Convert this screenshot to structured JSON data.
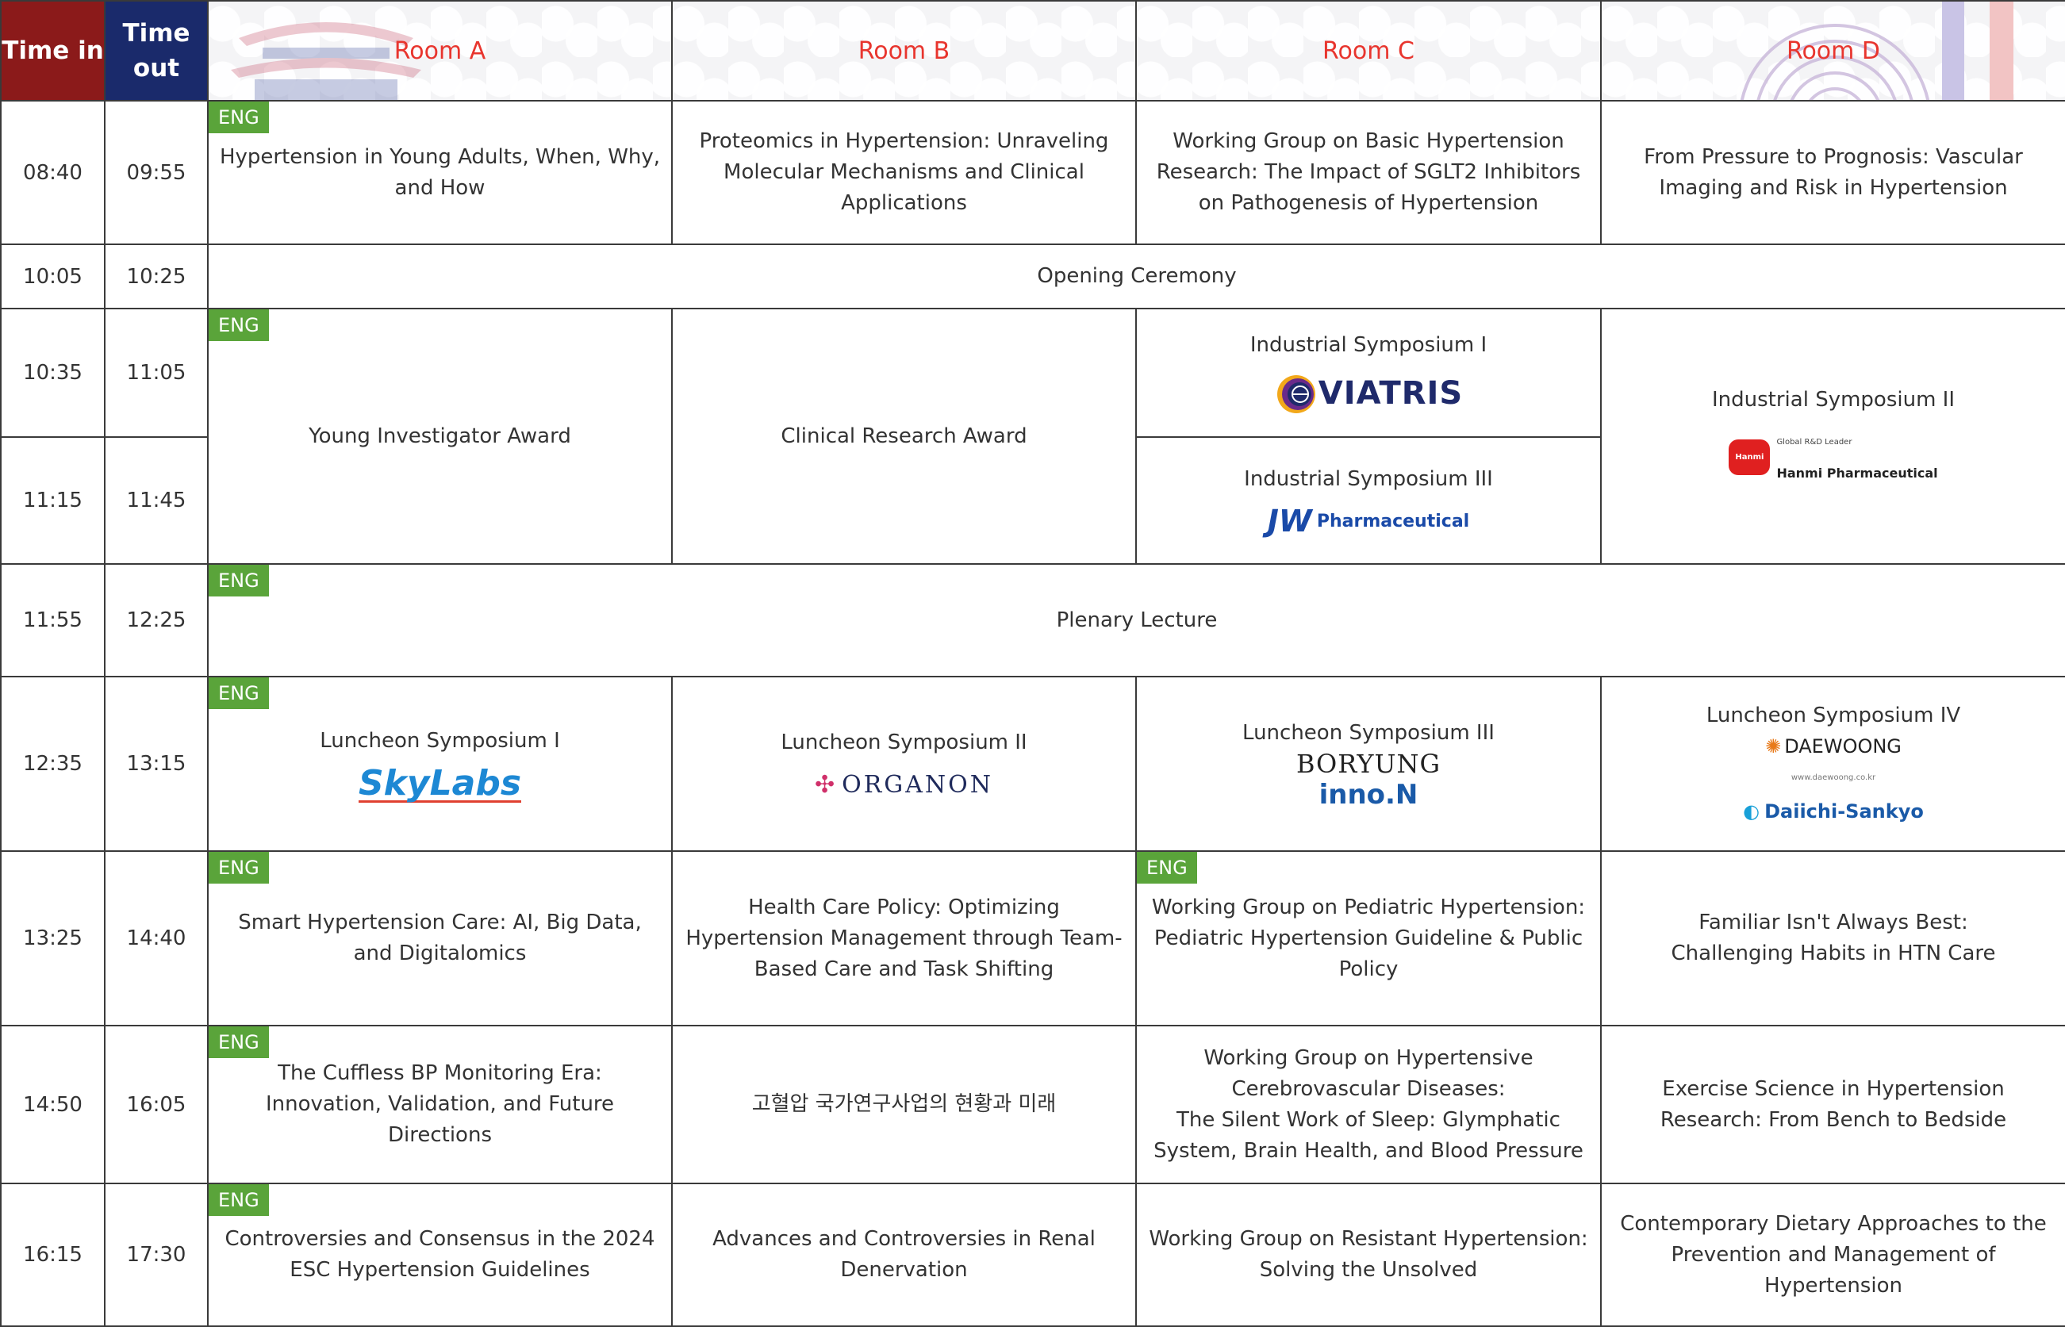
{
  "header": {
    "time_in": "Time in",
    "time_out": "Time out",
    "rooms": [
      "Room A",
      "Room B",
      "Room C",
      "Room D"
    ]
  },
  "eng_badge": "ENG",
  "rows": {
    "r1": {
      "in": "08:40",
      "out": "09:55",
      "a": "Hypertension in Young Adults, When, Why, and How",
      "b": "Proteomics in Hypertension: Unraveling Molecular Mechanisms and Clinical Applications",
      "c": "Working Group on Basic Hypertension Research: The Impact of SGLT2 Inhibitors on Pathogenesis of Hypertension",
      "d": "From Pressure to Prognosis: Vascular Imaging and Risk in Hypertension"
    },
    "r2": {
      "in": "10:05",
      "out": "10:25",
      "all": "Opening Ceremony"
    },
    "r3": {
      "in": "10:35",
      "out": "11:05",
      "a": "Young Investigator Award",
      "b": "Clinical Research Award",
      "c": "Industrial Symposium I",
      "c_logo": "VIATRIS",
      "d": "Industrial Symposium II",
      "d_logo_tag": "Global R&D Leader",
      "d_logo": "Hanmi Pharmaceutical",
      "d_logo_pill": "Hanmi"
    },
    "r4": {
      "in": "11:15",
      "out": "11:45",
      "c": "Industrial Symposium III",
      "c_logo_mark": "JW",
      "c_logo": "Pharmaceutical"
    },
    "r5": {
      "in": "11:55",
      "out": "12:25",
      "all": "Plenary Lecture"
    },
    "r6": {
      "in": "12:35",
      "out": "13:15",
      "a": "Luncheon Symposium I",
      "a_logo": "SkyLabs",
      "b": "Luncheon Symposium II",
      "b_logo": "ORGANON",
      "c": "Luncheon Symposium III",
      "c_logo1": "BORYUNG",
      "c_logo2": "inno.N",
      "d": "Luncheon Symposium IV",
      "d_logo1": "DAEWOONG",
      "d_logo1_url": "www.daewoong.co.kr",
      "d_logo2": "Daiichi-Sankyo"
    },
    "r7": {
      "in": "13:25",
      "out": "14:40",
      "a": "Smart Hypertension Care: AI, Big Data, and Digitalomics",
      "b": "Health Care Policy: Optimizing Hypertension Management through Team-Based Care and Task Shifting",
      "c": "Working Group on Pediatric Hypertension: Pediatric Hypertension Guideline & Public Policy",
      "d1": "Familiar Isn't Always Best:",
      "d2": "Challenging Habits in HTN Care"
    },
    "r8": {
      "in": "14:50",
      "out": "16:05",
      "a": "The Cuffless BP Monitoring Era: Innovation, Validation, and Future Directions",
      "b": "고혈압 국가연구사업의 현황과 미래",
      "c1": "Working Group on Hypertensive Cerebrovascular Diseases:",
      "c2": "The Silent Work of Sleep: Glymphatic System, Brain Health, and Blood Pressure",
      "d": "Exercise Science in Hypertension Research: From Bench to Bedside"
    },
    "r9": {
      "in": "16:15",
      "out": "17:30",
      "a": "Controversies and Consensus in the 2024 ESC Hypertension Guidelines",
      "b": "Advances and Controversies in Renal Denervation",
      "c": "Working Group on Resistant Hypertension: Solving the Unsolved",
      "d": "Contemporary Dietary Approaches to the Prevention and Management of Hypertension"
    }
  },
  "colors": {
    "time_in_bg": "#8b1a1a",
    "time_out_bg": "#1a2a6b",
    "room_label": "#e8352e",
    "eng_badge": "#5aa43a"
  }
}
